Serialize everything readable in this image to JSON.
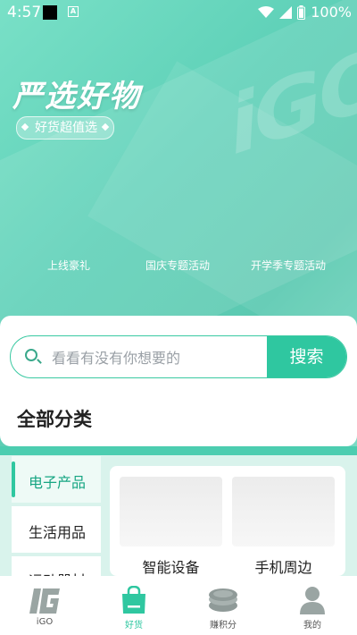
{
  "status_bar": {
    "time": "4:57",
    "battery": "100%"
  },
  "hero": {
    "title": "严选好物",
    "subtitle": "好货超值选",
    "watermark": "iGO",
    "tabs": [
      "上线豪礼",
      "国庆专题活动",
      "开学季专题活动"
    ]
  },
  "search": {
    "placeholder": "看看有没有你想要的",
    "button": "搜索"
  },
  "category_title": "全部分类",
  "sidebar": {
    "items": [
      "电子产品",
      "生活用品",
      "运动器材"
    ],
    "active_index": 0
  },
  "grid": {
    "items": [
      "智能设备",
      "手机周边"
    ]
  },
  "bottom_nav": {
    "items": [
      {
        "label": "iGO",
        "icon": "igo-logo-icon"
      },
      {
        "label": "好货",
        "icon": "shopping-bag-icon"
      },
      {
        "label": "赚积分",
        "icon": "coins-icon"
      },
      {
        "label": "我的",
        "icon": "user-icon"
      }
    ],
    "active_index": 1,
    "accent": "#2fc7a0"
  }
}
